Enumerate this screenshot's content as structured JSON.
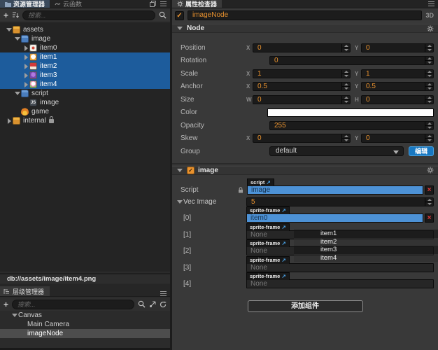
{
  "icons": {
    "check": "✓",
    "close": "×",
    "external_link": "↗",
    "plus": "+",
    "js": "JS"
  },
  "colors": {
    "selection_blue": "#1d5c9c",
    "drag_highlight_blue": "#4d92d6",
    "accent_orange": "#e9922e",
    "edit_button_blue": "#1878c2",
    "color_property_value": "#ffffff"
  },
  "assets_panel": {
    "tabs": {
      "explorer": "资源管理器",
      "cloud": "云函数"
    },
    "search_placeholder": "搜索...",
    "tree": [
      {
        "label": "assets"
      },
      {
        "label": "image"
      },
      {
        "label": "item0"
      },
      {
        "label": "item1"
      },
      {
        "label": "item2"
      },
      {
        "label": "item3"
      },
      {
        "label": "item4"
      },
      {
        "label": "script"
      },
      {
        "label": "image"
      },
      {
        "label": "game"
      },
      {
        "label": "internal"
      }
    ],
    "status_path": "db://assets/image/item4.png"
  },
  "hierarchy_panel": {
    "tab": "层级管理器",
    "search_placeholder": "搜索...",
    "tree": [
      {
        "label": "Canvas"
      },
      {
        "label": "Main Camera"
      },
      {
        "label": "imageNode"
      }
    ]
  },
  "inspector": {
    "tab": "属性检查器",
    "node_name": "imageNode",
    "mode_label": "3D",
    "axis": {
      "x": "X",
      "y": "Y",
      "w": "W",
      "h": "H"
    },
    "node_section": {
      "title": "Node",
      "position": {
        "label": "Position",
        "x": "0",
        "y": "0"
      },
      "rotation": {
        "label": "Rotation",
        "value": "0"
      },
      "scale": {
        "label": "Scale",
        "x": "1",
        "y": "1"
      },
      "anchor": {
        "label": "Anchor",
        "x": "0.5",
        "y": "0.5"
      },
      "size": {
        "label": "Size",
        "w": "0",
        "h": "0"
      },
      "color": {
        "label": "Color"
      },
      "opacity": {
        "label": "Opacity",
        "value": "255"
      },
      "skew": {
        "label": "Skew",
        "x": "0",
        "y": "0"
      },
      "group": {
        "label": "Group",
        "value": "default",
        "edit_label": "编辑"
      }
    },
    "image_section": {
      "title": "image",
      "script_label": "Script",
      "script_type": "script",
      "script_value": "image",
      "vec_label": "Vec Image",
      "vec_count": "5",
      "items": [
        {
          "index": "[0]",
          "type": "sprite-frame",
          "value": "item0"
        },
        {
          "index": "[1]",
          "type": "sprite-frame",
          "value": "None"
        },
        {
          "index": "[2]",
          "type": "sprite-frame",
          "value": "None"
        },
        {
          "index": "[3]",
          "type": "sprite-frame",
          "value": "None"
        },
        {
          "index": "[4]",
          "type": "sprite-frame",
          "value": "None"
        }
      ],
      "add_component_label": "添加组件"
    },
    "drag_ghost": [
      "item1",
      "item2",
      "item3",
      "item4"
    ]
  }
}
